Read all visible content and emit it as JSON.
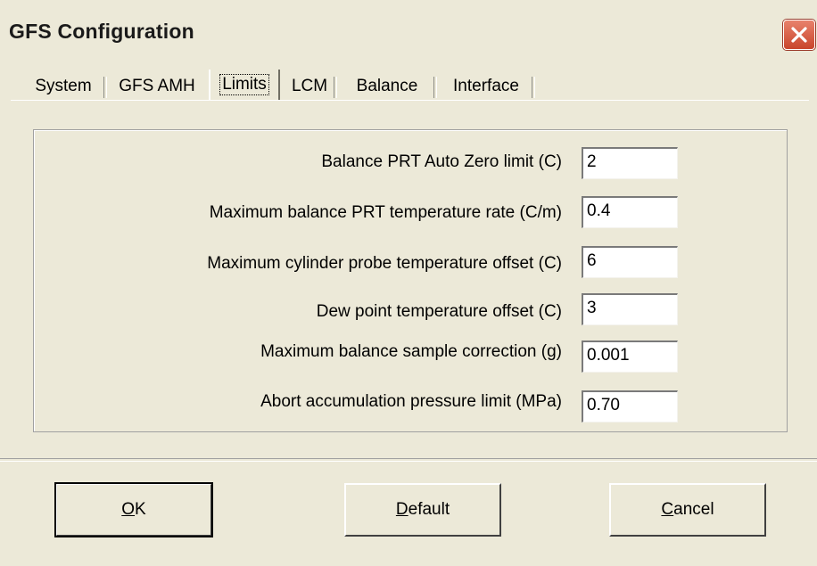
{
  "window": {
    "title": "GFS Configuration"
  },
  "tabs": [
    {
      "label": "System",
      "active": false
    },
    {
      "label": "GFS AMH",
      "active": false
    },
    {
      "label": "Limits",
      "active": true
    },
    {
      "label": "LCM",
      "active": false
    },
    {
      "label": "Balance",
      "active": false
    },
    {
      "label": "Interface",
      "active": false
    }
  ],
  "limits": [
    {
      "label": "Balance PRT Auto Zero limit (C)",
      "value": "2"
    },
    {
      "label": "Maximum balance PRT temperature rate (C/m)",
      "value": "0.4"
    },
    {
      "label": "Maximum cylinder probe temperature offset (C)",
      "value": "6"
    },
    {
      "label": "Dew point temperature offset (C)",
      "value": "3"
    },
    {
      "label": "Maximum balance sample correction (g)",
      "value": "0.001"
    },
    {
      "label": "Abort accumulation pressure limit (MPa)",
      "value": "0.70"
    }
  ],
  "buttons": {
    "ok": {
      "mnemonic": "O",
      "rest": "K"
    },
    "default": {
      "mnemonic": "D",
      "rest": "efault"
    },
    "cancel": {
      "mnemonic": "C",
      "rest": "ancel"
    }
  },
  "icons": {
    "close": "close-icon"
  },
  "colors": {
    "face": "#ece9d8",
    "close_button": "#d0533a"
  }
}
